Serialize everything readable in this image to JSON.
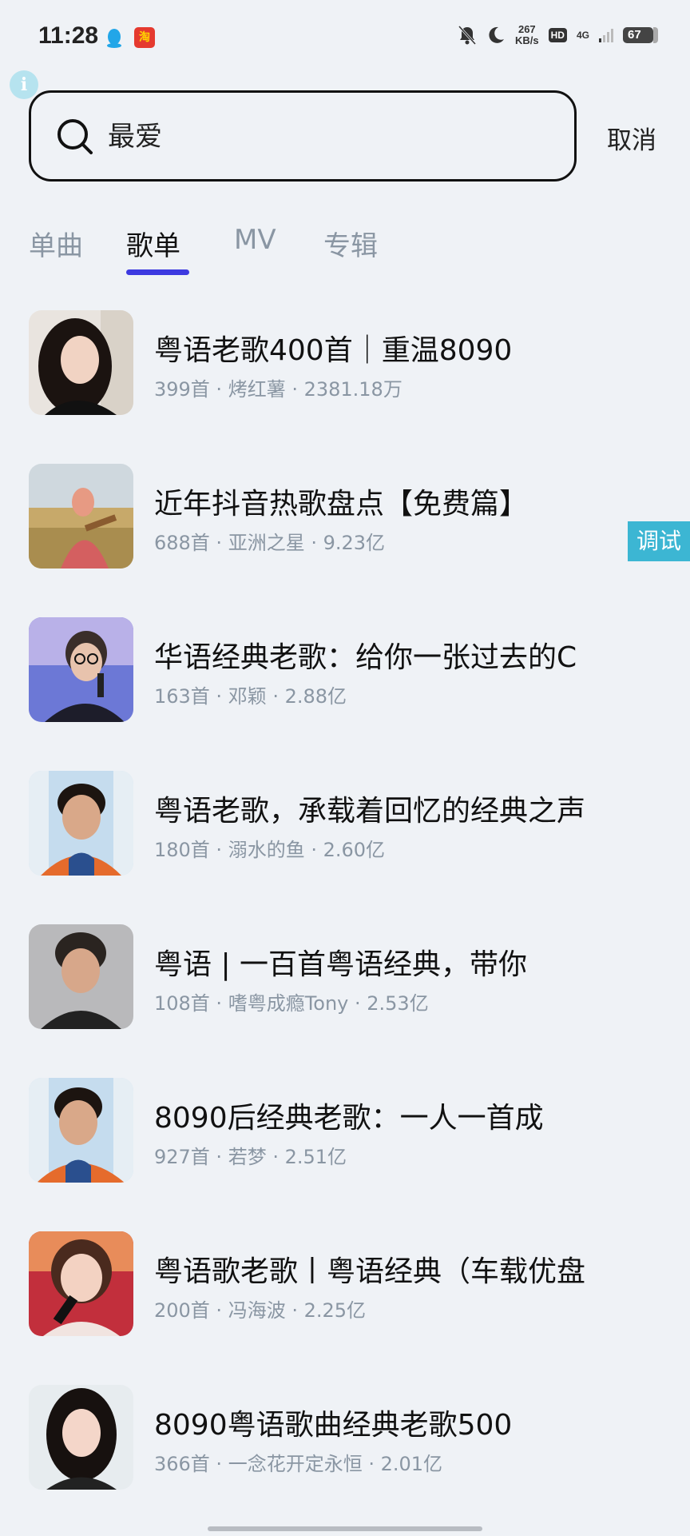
{
  "status": {
    "time": "11:28",
    "net_speed_value": "267",
    "net_speed_unit": "KB/s",
    "hd": "HD",
    "network": "4G",
    "battery": "67"
  },
  "search": {
    "query": "最爱",
    "cancel_label": "取消"
  },
  "tabs": [
    {
      "label": "单曲",
      "active": false
    },
    {
      "label": "歌单",
      "active": true
    },
    {
      "label": "MV",
      "active": false
    },
    {
      "label": "专辑",
      "active": false
    }
  ],
  "playlists": [
    {
      "title": "粤语老歌400首｜重温8090",
      "meta": "399首 · 烤红薯 · 2381.18万"
    },
    {
      "title": "近年抖音热歌盘点【免费篇】",
      "meta": "688首 · 亚洲之星 · 9.23亿"
    },
    {
      "title": "华语经典老歌：给你一张过去的C",
      "meta": "163首 · 邓颖 · 2.88亿"
    },
    {
      "title": "粤语老歌，承载着回忆的经典之声",
      "meta": "180首 · 溺水的鱼 · 2.60亿"
    },
    {
      "title": "粤语 | 一百首粤语经典，带你",
      "meta": "108首 · 嗜粤成瘾Tony · 2.53亿"
    },
    {
      "title": "8090后经典老歌：一人一首成",
      "meta": "927首 · 若梦 · 2.51亿"
    },
    {
      "title": "粤语歌老歌丨粤语经典（车载优盘",
      "meta": "200首 · 冯海波 · 2.25亿"
    },
    {
      "title": "8090粤语歌曲经典老歌500",
      "meta": "366首 · 一念花开定永恒 · 2.01亿"
    }
  ],
  "debug_label": "调试",
  "colors": {
    "background": "#eff2f6",
    "tab_accent": "#3d3ae0",
    "debug_tag": "#3cb6d3",
    "meta_text": "#8a96a3"
  }
}
